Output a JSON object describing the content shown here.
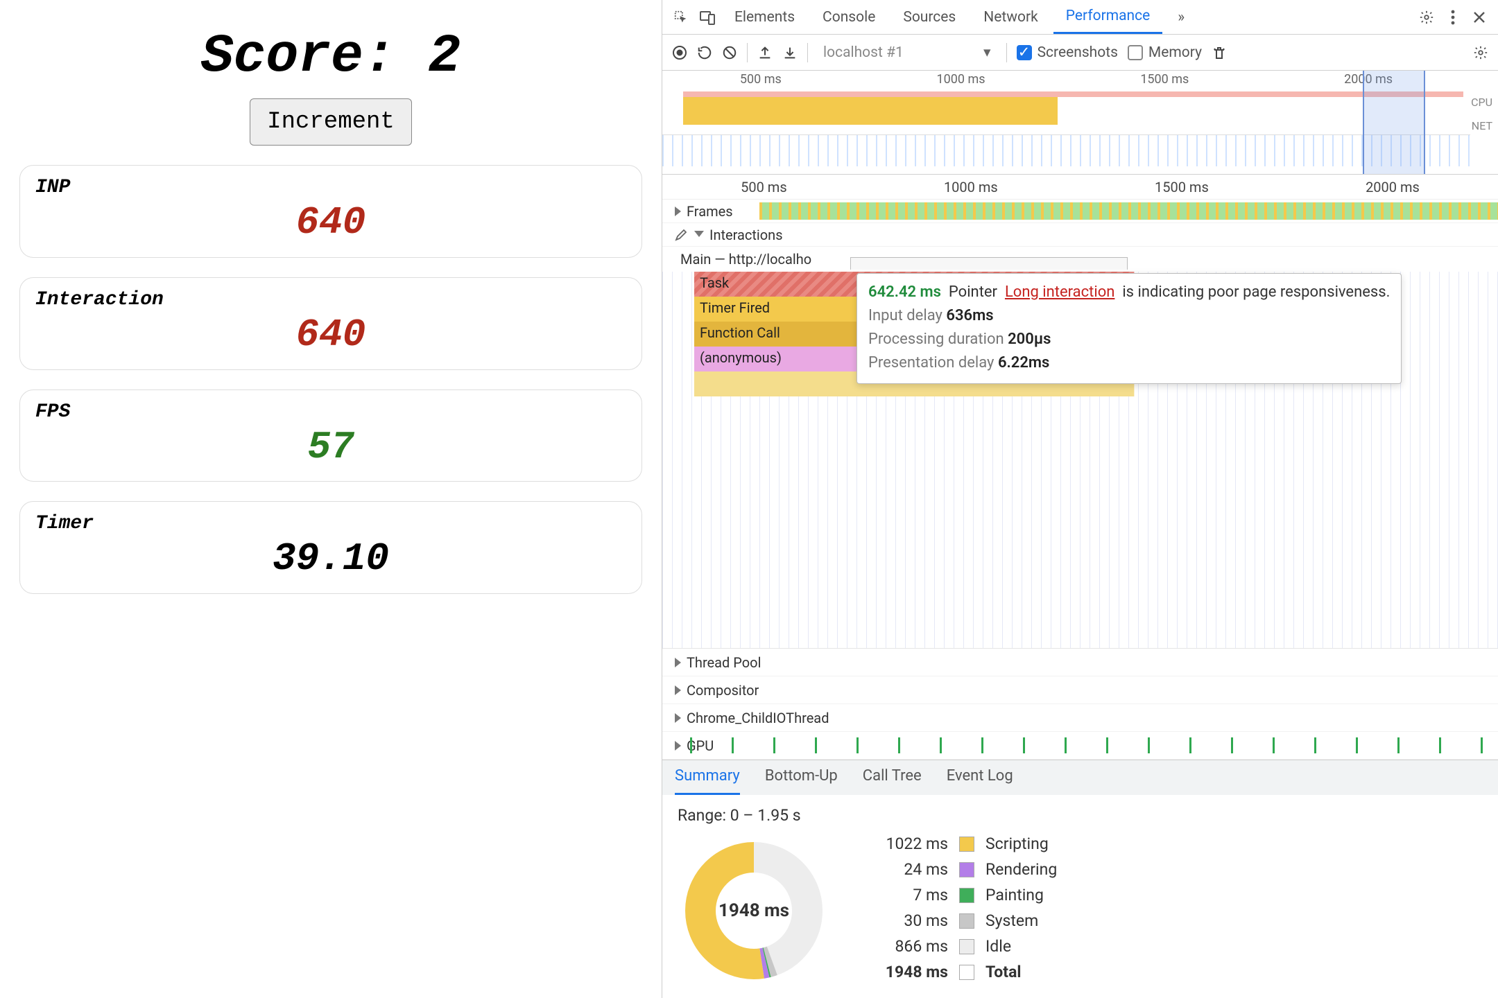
{
  "app": {
    "score_label": "Score:",
    "score_value": "2",
    "increment_label": "Increment",
    "metrics": {
      "inp": {
        "label": "INP",
        "value": "640"
      },
      "interaction": {
        "label": "Interaction",
        "value": "640"
      },
      "fps": {
        "label": "FPS",
        "value": "57"
      },
      "timer": {
        "label": "Timer",
        "value": "39.10"
      }
    }
  },
  "devtools": {
    "tabs": {
      "elements": "Elements",
      "console": "Console",
      "sources": "Sources",
      "network": "Network",
      "performance": "Performance",
      "more": "»"
    },
    "toolbar": {
      "host_label": "localhost #1",
      "screenshots_label": "Screenshots",
      "memory_label": "Memory"
    },
    "overview": {
      "ticks": [
        "500 ms",
        "1000 ms",
        "1500 ms",
        "2000 ms"
      ],
      "cpu_label": "CPU",
      "net_label": "NET"
    },
    "ruler_ticks": [
      "500 ms",
      "1000 ms",
      "1500 ms",
      "2000 ms"
    ],
    "tracks": {
      "frames": "Frames",
      "interactions": "Interactions",
      "main": "Main — http://localho",
      "thread_pool": "Thread Pool",
      "compositor": "Compositor",
      "child_io": "Chrome_ChildIOThread",
      "gpu": "GPU"
    },
    "flame": {
      "task": "Task",
      "timer_fired": "Timer Fired",
      "function_call": "Function Call",
      "anonymous": "(anonymous)"
    },
    "tooltip": {
      "time": "642.42 ms",
      "kind": "Pointer",
      "link_text": "Long interaction",
      "tail": "is indicating poor page responsiveness.",
      "input_delay_label": "Input delay",
      "input_delay_value": "636ms",
      "processing_label": "Processing duration",
      "processing_value": "200µs",
      "presentation_label": "Presentation delay",
      "presentation_value": "6.22ms"
    },
    "summary": {
      "tabs": {
        "summary": "Summary",
        "bottom_up": "Bottom-Up",
        "call_tree": "Call Tree",
        "event_log": "Event Log"
      },
      "range": "Range: 0 – 1.95 s",
      "donut_center": "1948 ms",
      "rows": {
        "scripting": {
          "ms": "1022 ms",
          "label": "Scripting"
        },
        "rendering": {
          "ms": "24 ms",
          "label": "Rendering"
        },
        "painting": {
          "ms": "7 ms",
          "label": "Painting"
        },
        "system": {
          "ms": "30 ms",
          "label": "System"
        },
        "idle": {
          "ms": "866 ms",
          "label": "Idle"
        },
        "total": {
          "ms": "1948 ms",
          "label": "Total"
        }
      }
    }
  },
  "chart_data": {
    "type": "pie",
    "title": "Performance summary breakdown",
    "units": "ms",
    "total": 1948,
    "series": [
      {
        "name": "Scripting",
        "value": 1022,
        "color": "#f3c94c"
      },
      {
        "name": "Rendering",
        "value": 24,
        "color": "#b37ee8"
      },
      {
        "name": "Painting",
        "value": 7,
        "color": "#3fae5a"
      },
      {
        "name": "System",
        "value": 30,
        "color": "#c7c7c7"
      },
      {
        "name": "Idle",
        "value": 866,
        "color": "#ededed"
      }
    ]
  }
}
